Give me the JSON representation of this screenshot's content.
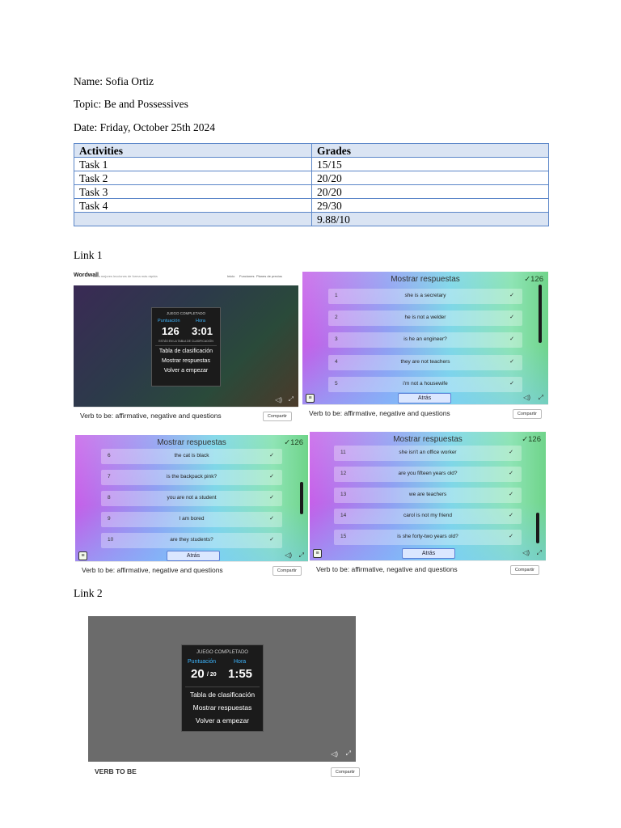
{
  "header": {
    "name": "Name: Sofia Ortiz",
    "topic": "Topic: Be and Possessives",
    "date": "Date: Friday, October 25th 2024"
  },
  "grades_table": {
    "headers": [
      "Activities",
      "Grades"
    ],
    "rows": [
      [
        "Task 1",
        "15/15"
      ],
      [
        "Task 2",
        "20/20"
      ],
      [
        "Task 3",
        "20/20"
      ],
      [
        "Task 4",
        "29/30"
      ]
    ],
    "total": [
      "",
      "9.88/10"
    ]
  },
  "link1": "Link 1",
  "link2": "Link 2",
  "wordwall": {
    "logo": "Wordwall",
    "tagline": "Crea mejores lecciones de forma más rápida",
    "nav": [
      "Inicio",
      "Funciones",
      "Planes de precios"
    ],
    "completed": "JUEGO COMPLETADO",
    "score_label": "Puntuación",
    "time_label": "Hora",
    "score1": "126",
    "time1": "3:01",
    "leaderboard_note": "ESTÁS EN LA TABLA DE CLASIFICACIÓN",
    "menu": [
      "Tabla de clasificación",
      "Mostrar respuestas",
      "Volver a empezar"
    ],
    "activity1_title": "Verb to be: affirmative, negative and questions",
    "share": "Compartir",
    "answers_title": "Mostrar respuestas",
    "answers_count": "✓126",
    "back": "Atrás",
    "answers": [
      [
        "1",
        "she is a secretary"
      ],
      [
        "2",
        "he is not a welder"
      ],
      [
        "3",
        "is he an engineer?"
      ],
      [
        "4",
        "they are not teachers"
      ],
      [
        "5",
        "i'm not a housewife"
      ],
      [
        "6",
        "the cat is black"
      ],
      [
        "7",
        "is the backpack pink?"
      ],
      [
        "8",
        "you are not a student"
      ],
      [
        "9",
        "I am bored"
      ],
      [
        "10",
        "are they students?"
      ],
      [
        "11",
        "she isn't an office worker"
      ],
      [
        "12",
        "are you fifteen years old?"
      ],
      [
        "13",
        "we are teachers"
      ],
      [
        "14",
        "carol is not my friend"
      ],
      [
        "15",
        "is she forty-two years old?"
      ]
    ],
    "check": "✓",
    "score2": "20",
    "score2_total": "/ 20",
    "time2": "1:55",
    "activity2_title": "VERB TO BE"
  }
}
